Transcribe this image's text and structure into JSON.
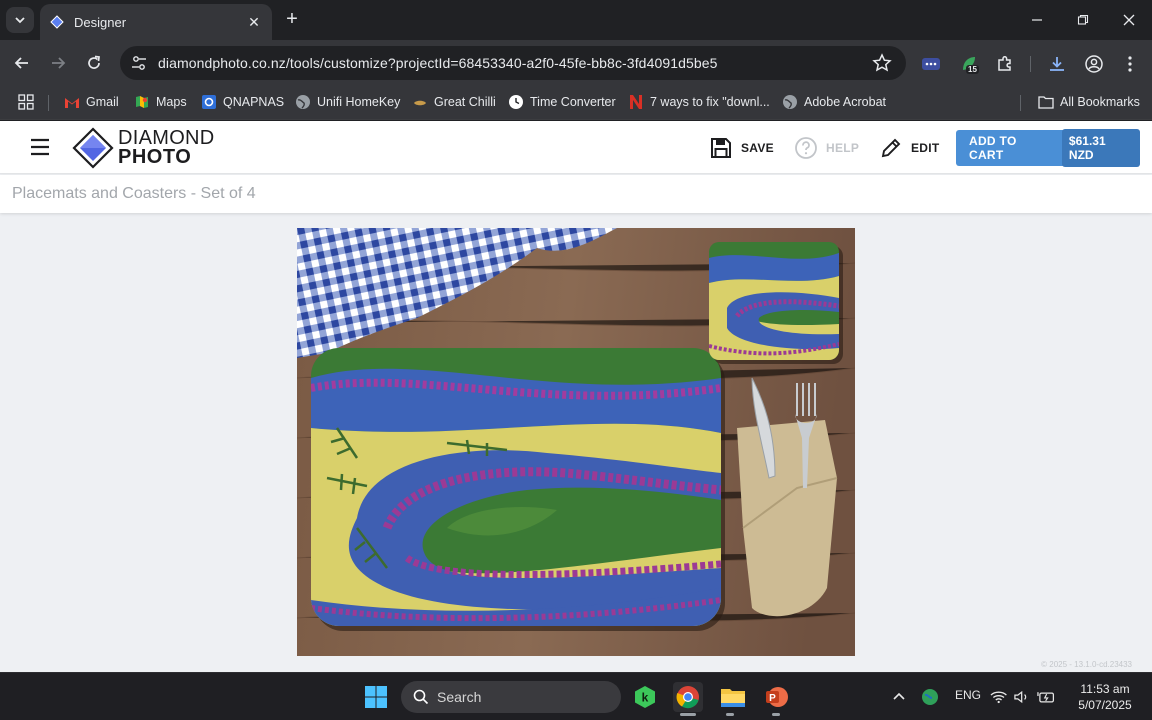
{
  "browser": {
    "tab_title": "Designer",
    "url": "diamondphoto.co.nz/tools/customize?projectId=68453340-a2f0-45fe-bb8c-3fd4091d5be5",
    "extension_badge": "15",
    "bookmarks": [
      {
        "label": "Gmail",
        "icon": "gmail-icon"
      },
      {
        "label": "Maps",
        "icon": "maps-icon"
      },
      {
        "label": "QNAPNAS",
        "icon": "qnap-icon"
      },
      {
        "label": "Unifi HomeKey",
        "icon": "globe-icon"
      },
      {
        "label": "Great Chilli",
        "icon": "chilli-icon"
      },
      {
        "label": "Time Converter",
        "icon": "clock-icon"
      },
      {
        "label": "7 ways to fix \"downl...",
        "icon": "n-icon"
      },
      {
        "label": "Adobe Acrobat",
        "icon": "globe-icon"
      }
    ],
    "all_bookmarks": "All Bookmarks"
  },
  "site": {
    "logo_line1": "DIAMOND",
    "logo_line2": "PHOTO",
    "save_label": "SAVE",
    "help_label": "HELP",
    "edit_label": "EDIT",
    "cart_label": "ADD TO CART",
    "cart_price": "$61.31 NZD",
    "product_title": "Placemats and Coasters - Set of 4",
    "version": "© 2025 - 13.1.0-cd.23433",
    "colors": {
      "accent": "#4a8fd6",
      "accent_dark": "#3b78ba"
    }
  },
  "taskbar": {
    "search_label": "Search",
    "language": "ENG",
    "time": "11:53 am",
    "date": "5/07/2025"
  }
}
